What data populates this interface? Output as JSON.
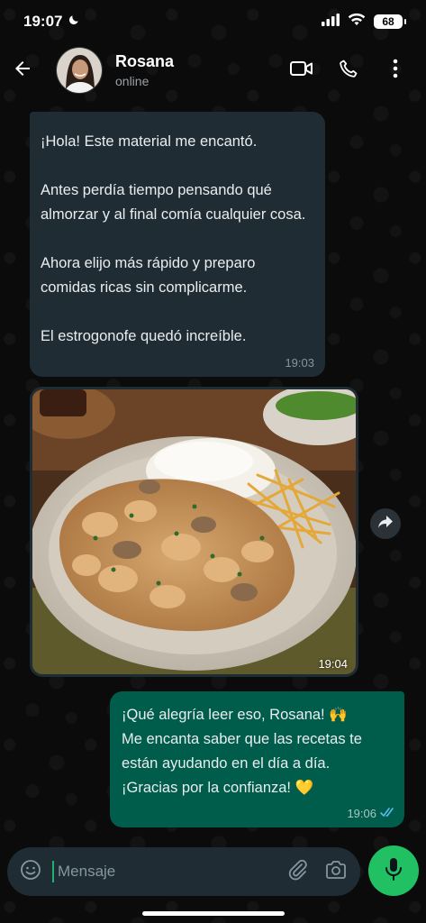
{
  "status_bar": {
    "time": "19:07",
    "battery": "68"
  },
  "header": {
    "contact_name": "Rosana",
    "contact_status": "online"
  },
  "messages": {
    "incoming_text": {
      "lines": [
        "¡Hola! Este material me encantó.",
        "Antes perdía tiempo pensando qué almorzar y al final comía cualquier cosa.",
        "Ahora elijo más rápido y preparo comidas ricas sin complicarme.",
        "El estrogonofe quedó increíble."
      ],
      "time": "19:03"
    },
    "incoming_image": {
      "time": "19:04"
    },
    "outgoing_text": {
      "line1": "¡Qué alegría leer eso, Rosana! 🙌",
      "line2": "Me encanta saber que las recetas te están ayudando en el día a día.",
      "line3": "¡Gracias por la confianza! 💛",
      "time": "19:06"
    }
  },
  "composer": {
    "placeholder": "Mensaje"
  },
  "colors": {
    "incoming_bubble": "#202c33",
    "outgoing_bubble": "#005c4b",
    "accent_green": "#21c063",
    "read_ticks": "#53bdeb"
  }
}
